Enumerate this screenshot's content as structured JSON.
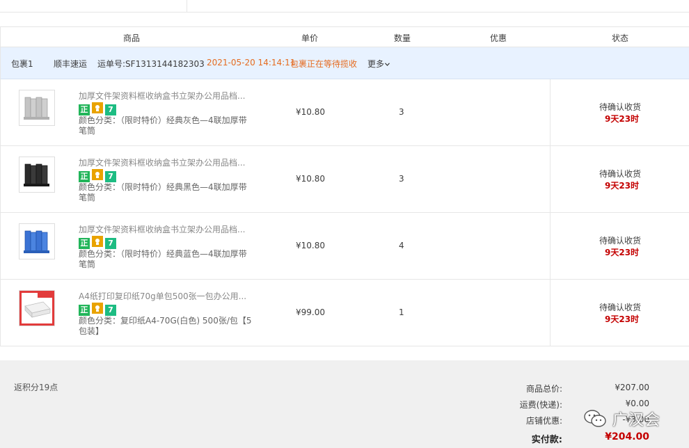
{
  "table": {
    "headers": {
      "product": "商品",
      "unit_price": "单价",
      "quantity": "数量",
      "discount": "优惠",
      "status": "状态"
    }
  },
  "package": {
    "name": "包裹1",
    "carrier": "顺丰速运",
    "tracking": "运单号:SF1313144182303",
    "datetime": "2021-05-20 14:14:11",
    "state": "包裹正在等待揽收",
    "more": "更多",
    "more_icon": "chevron-down-icon"
  },
  "items": [
    {
      "title": "加厚文件架资料框收纳盒书立架办公用品档...",
      "badges": [
        "正",
        "",
        "7"
      ],
      "sku": "颜色分类：（限时特价）经典灰色—4联加厚带笔筒",
      "price": "¥10.80",
      "qty": "3",
      "status": "待确认收货",
      "timer": "9天23时",
      "thumb_color": "#bfbfbf"
    },
    {
      "title": "加厚文件架资料框收纳盒书立架办公用品档...",
      "badges": [
        "正",
        "",
        "7"
      ],
      "sku": "颜色分类：（限时特价）经典黑色—4联加厚带笔筒",
      "price": "¥10.80",
      "qty": "3",
      "status": "待确认收货",
      "timer": "9天23时",
      "thumb_color": "#2b2b2b"
    },
    {
      "title": "加厚文件架资料框收纳盒书立架办公用品档...",
      "badges": [
        "正",
        "",
        "7"
      ],
      "sku": "颜色分类：（限时特价）经典蓝色—4联加厚带笔筒",
      "price": "¥10.80",
      "qty": "4",
      "status": "待确认收货",
      "timer": "9天23时",
      "thumb_color": "#3b73d4"
    },
    {
      "title": "A4纸打印复印纸70g单包500张一包办公用...",
      "badges": [
        "正",
        "",
        "7"
      ],
      "sku": "颜色分类：复印纸A4-70G(白色) 500张/包【5包装】",
      "price": "¥99.00",
      "qty": "1",
      "status": "待确认收货",
      "timer": "9天23时",
      "thumb_color": "#e23b3b"
    }
  ],
  "summary": {
    "points": "返积分19点",
    "goods_total_label": "商品总价:",
    "goods_total": "¥207.00",
    "shipping_label": "运费(快递):",
    "shipping": "¥0.00",
    "shop_discount_label": "店铺优惠:",
    "shop_discount": "-¥3.00",
    "paid_label": "实付款:",
    "paid": "¥204.00"
  },
  "watermark": {
    "icon": "wechat-icon",
    "text": "广汉会"
  },
  "colors": {
    "accent_orange": "#e56b1f",
    "price_red": "#c40000",
    "package_bar_bg": "#e8f2ff"
  }
}
